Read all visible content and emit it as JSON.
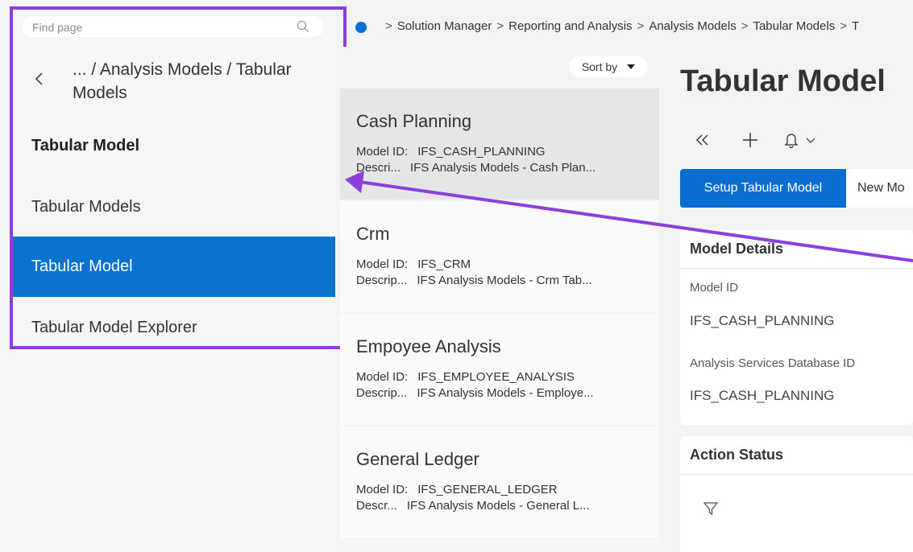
{
  "nav": {
    "search_placeholder": "Find page",
    "breadcrumb": "... / Analysis Models / Tabular Models",
    "heading": "Tabular Model",
    "items": [
      {
        "label": "Tabular Models"
      },
      {
        "label": "Tabular Model"
      },
      {
        "label": "Tabular Model Explorer"
      }
    ],
    "selected_index": 1
  },
  "breadcrumb_bar": {
    "items": [
      "Solution Manager",
      "Reporting and Analysis",
      "Analysis Models",
      "Tabular Models",
      "T"
    ],
    "separator": ">"
  },
  "list": {
    "sort_label": "Sort by",
    "cards": [
      {
        "title": "Cash Planning",
        "id_label": "Model ID:",
        "id_value": "IFS_CASH_PLANNING",
        "desc_label": "Descri...",
        "desc_value": "IFS Analysis Models - Cash Plan..."
      },
      {
        "title": "Crm",
        "id_label": "Model ID:",
        "id_value": "IFS_CRM",
        "desc_label": "Descrip...",
        "desc_value": "IFS Analysis Models - Crm Tab..."
      },
      {
        "title": "Empoyee Analysis",
        "id_label": "Model ID:",
        "id_value": "IFS_EMPLOYEE_ANALYSIS",
        "desc_label": "Descrip...",
        "desc_value": "IFS Analysis Models - Employe..."
      },
      {
        "title": "General Ledger",
        "id_label": "Model ID:",
        "id_value": "IFS_GENERAL_LEDGER",
        "desc_label": "Descr...",
        "desc_value": "IFS Analysis Models - General L..."
      }
    ]
  },
  "detail": {
    "title": "Tabular Model",
    "tabs": {
      "primary": "Setup Tabular Model",
      "secondary": "New Mo"
    },
    "model_details": {
      "heading": "Model Details",
      "model_id_label": "Model ID",
      "model_id_value": "IFS_CASH_PLANNING",
      "db_id_label": "Analysis Services Database ID",
      "db_id_value": "IFS_CASH_PLANNING"
    },
    "action_status": {
      "heading": "Action Status"
    }
  },
  "colors": {
    "accent": "#0a6ed1",
    "highlight": "#8b3fdc"
  }
}
